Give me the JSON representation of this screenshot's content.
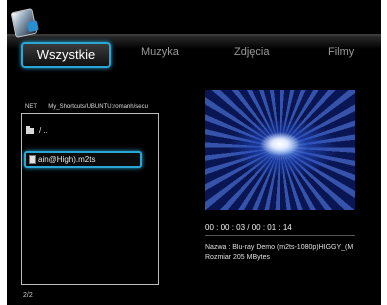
{
  "tabs": {
    "active": "Wszystkie",
    "music": "Muzyka",
    "photos": "Zdjęcia",
    "films": "Filmy"
  },
  "browser": {
    "path_net": "NET",
    "path": "My_Shortcuts/UBUNTU:romanh/secu",
    "folder_up": "/ ..",
    "selected_file": "ain@High).m2ts",
    "page": "2/2"
  },
  "details": {
    "time": "00 : 00 : 03 / 00 : 01 : 14",
    "name": "Nazwa : Blu-ray Demo (m2ts-1080p)HIGGY_(M",
    "size": "Rozmiar  205 MBytes"
  },
  "icons": {
    "logo": "media-player-logo-icon",
    "folder": "folder-icon",
    "file": "video-file-icon"
  },
  "colors": {
    "accent": "#2aa6d6",
    "background": "#000000"
  }
}
